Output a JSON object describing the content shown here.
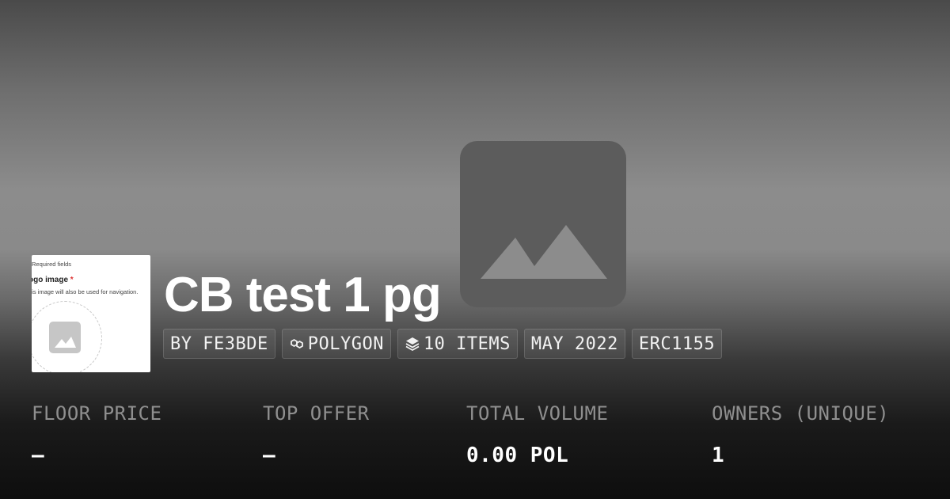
{
  "avatar": {
    "required_note": "Required fields",
    "logo_label": "ogo image",
    "required_star": "*",
    "navigation_note": "his image will also be used for navigation."
  },
  "collection": {
    "title": "CB test 1 pg"
  },
  "tags": {
    "creator": "BY FE3BDE",
    "chain": "POLYGON",
    "items": "10 ITEMS",
    "date": "MAY 2022",
    "standard": "ERC1155"
  },
  "icons": {
    "chain_icon": "polygon-link-icon",
    "items_icon": "layers-icon",
    "hero_icon": "image-placeholder-icon"
  },
  "stats": {
    "floor_price": {
      "label": "FLOOR PRICE",
      "value": "–"
    },
    "top_offer": {
      "label": "TOP OFFER",
      "value": "–"
    },
    "total_volume": {
      "label": "TOTAL VOLUME",
      "value": "0.00 POL"
    },
    "owners": {
      "label": "OWNERS (UNIQUE)",
      "value": "1"
    }
  },
  "colors": {
    "label_gray": "#8f8f8f",
    "placeholder_gray": "#5c5c5c"
  }
}
